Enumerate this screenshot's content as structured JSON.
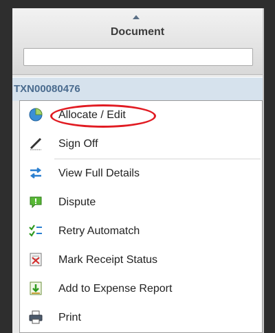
{
  "column": {
    "title": "Document",
    "filter_value": ""
  },
  "row": {
    "txn_id": "TXN00080476"
  },
  "menu": {
    "items": [
      {
        "label": "Allocate / Edit",
        "icon": "pie-chart-icon"
      },
      {
        "label": "Sign Off",
        "icon": "pen-icon"
      },
      {
        "label": "View Full Details",
        "icon": "swap-arrows-icon"
      },
      {
        "label": "Dispute",
        "icon": "speech-bubble-exclamation-icon"
      },
      {
        "label": "Retry Automatch",
        "icon": "checklist-icon"
      },
      {
        "label": "Mark Receipt Status",
        "icon": "receipt-icon"
      },
      {
        "label": "Add to Expense Report",
        "icon": "add-to-report-icon"
      },
      {
        "label": "Print",
        "icon": "printer-icon"
      }
    ]
  },
  "colors": {
    "highlight": "#e11b22",
    "row_selected": "#d6e2ed",
    "txn_text": "#4a6b8e"
  }
}
